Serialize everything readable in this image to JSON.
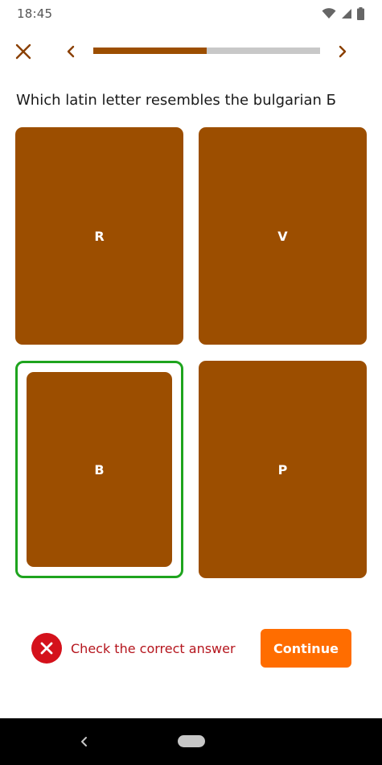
{
  "status_bar": {
    "time": "18:45",
    "icons": [
      "wifi-icon",
      "signal-icon",
      "battery-icon"
    ]
  },
  "nav": {
    "close_icon": "close-icon",
    "prev_icon": "chevron-left-icon",
    "next_icon": "chevron-right-icon",
    "progress_fraction": 0.5
  },
  "question": "Which latin letter resembles the bulgarian Б",
  "options": [
    {
      "label": "R",
      "selected": false
    },
    {
      "label": "V",
      "selected": false
    },
    {
      "label": "B",
      "selected": true
    },
    {
      "label": "P",
      "selected": false
    }
  ],
  "feedback": {
    "icon": "error-icon",
    "message": "Check the correct answer"
  },
  "actions": {
    "continue_label": "Continue"
  },
  "colors": {
    "card": "#9c4e00",
    "progress_fill": "#9c4e00",
    "progress_track": "#c8c8c8",
    "selected_border": "#1ea41e",
    "error": "#d4111b",
    "error_text": "#b5151d",
    "primary_button": "#ff6d00"
  }
}
